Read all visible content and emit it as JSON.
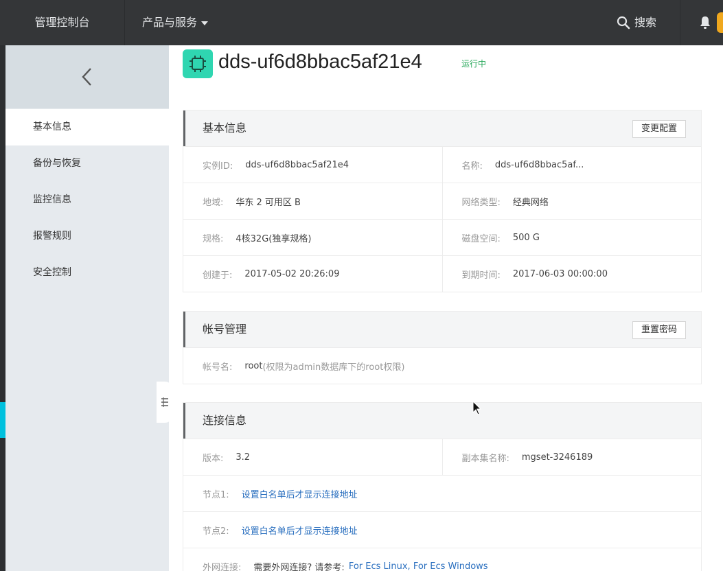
{
  "topbar": {
    "brand": "管理控制台",
    "products": "产品与服务",
    "search": "搜索"
  },
  "sidebar": {
    "items": [
      {
        "label": "基本信息",
        "active": true
      },
      {
        "label": "备份与恢复"
      },
      {
        "label": "监控信息"
      },
      {
        "label": "报警规则"
      },
      {
        "label": "安全控制"
      }
    ]
  },
  "instance": {
    "title": "dds-uf6d8bbac5af21e4",
    "status": "运行中"
  },
  "basic": {
    "title": "基本信息",
    "button": "变更配置",
    "rows": [
      [
        {
          "k": "实例ID:",
          "v": "dds-uf6d8bbac5af21e4"
        },
        {
          "k": "名称:",
          "v": "dds-uf6d8bbac5af..."
        }
      ],
      [
        {
          "k": "地域:",
          "v": "华东 2 可用区 B"
        },
        {
          "k": "网络类型:",
          "v": "经典网络"
        }
      ],
      [
        {
          "k": "规格:",
          "v": "4核32G(独享规格)"
        },
        {
          "k": "磁盘空间:",
          "v": "500 G"
        }
      ],
      [
        {
          "k": "创建于:",
          "v": "2017-05-02 20:26:09"
        },
        {
          "k": "到期时间:",
          "v": "2017-06-03 00:00:00"
        }
      ]
    ]
  },
  "account": {
    "title": "帐号管理",
    "button": "重置密码",
    "name_key": "帐号名:",
    "name_value": "root",
    "name_hint": "(权限为admin数据库下的root权限)"
  },
  "connection": {
    "title": "连接信息",
    "version_key": "版本:",
    "version_value": "3.2",
    "replica_key": "副本集名称:",
    "replica_value": "mgset-3246189",
    "node1_key": "节点1:",
    "node1_link": "设置白名单后才显示连接地址",
    "node2_key": "节点2:",
    "node2_link": "设置白名单后才显示连接地址",
    "external_key": "外网连接:",
    "external_text": "需要外网连接? 请参考:",
    "external_link": "For Ecs Linux, For Ecs Windows"
  },
  "colors": {
    "topbar": "#343638",
    "sidebar": "#e6eaee",
    "accent": "#00c1de",
    "status": "#27a85a",
    "icon_bg": "#2fd6b1",
    "link": "#2a6fbf"
  }
}
